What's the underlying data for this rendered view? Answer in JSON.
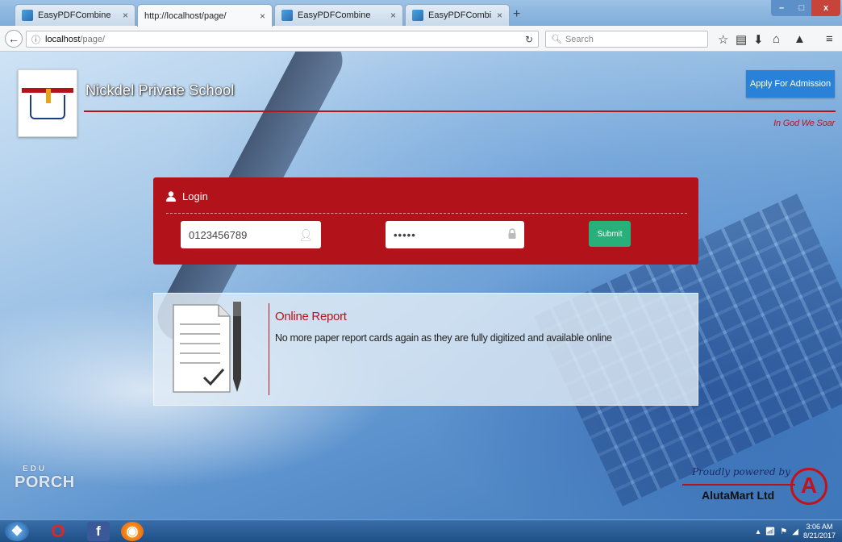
{
  "browser": {
    "tabs": [
      {
        "label": "EasyPDFCombine"
      },
      {
        "label": "http://localhost/page/"
      },
      {
        "label": "EasyPDFCombine"
      },
      {
        "label": "EasyPDFCombine"
      }
    ],
    "url_host": "localhost",
    "url_path": "/page/",
    "search_placeholder": "Search"
  },
  "header": {
    "school_name": "Nickdel Private School",
    "apply_label": "Apply For Admission",
    "motto": "In God We Soar",
    "accent_color": "#b3141b"
  },
  "login": {
    "title": "Login",
    "username_value": "0123456789",
    "password_value": "•••••",
    "submit_label": "Submit",
    "panel_color": "#b2131a",
    "submit_color": "#27b07a"
  },
  "feature": {
    "title": "Online Report",
    "description": "No more paper report cards again as they are fully digitized and available online"
  },
  "footer": {
    "brand_top": "EDU",
    "brand_bottom": "PORCH",
    "powered_text": "Proudly powered by",
    "powered_name": "AlutaMart Ltd"
  },
  "taskbar": {
    "time": "3:06 AM",
    "date": "8/21/2017"
  }
}
